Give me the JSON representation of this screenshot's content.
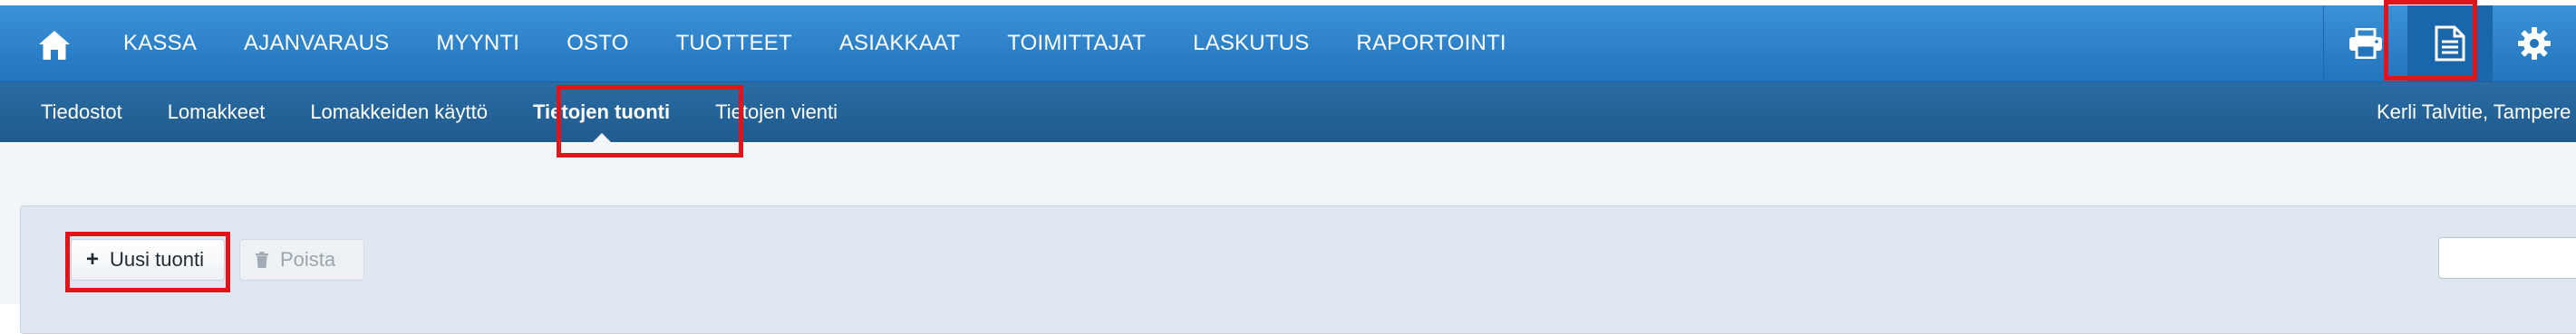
{
  "topnav": {
    "items": [
      {
        "label": "KASSA"
      },
      {
        "label": "AJANVARAUS"
      },
      {
        "label": "MYYNTI"
      },
      {
        "label": "OSTO"
      },
      {
        "label": "TUOTTEET"
      },
      {
        "label": "ASIAKKAAT"
      },
      {
        "label": "TOIMITTAJAT"
      },
      {
        "label": "LASKUTUS"
      },
      {
        "label": "RAPORTOINTI"
      }
    ],
    "icons": [
      "home-icon",
      "printer-icon",
      "document-icon",
      "gear-icon"
    ]
  },
  "subnav": {
    "items": [
      {
        "label": "Tiedostot"
      },
      {
        "label": "Lomakkeet"
      },
      {
        "label": "Lomakkeiden käyttö"
      },
      {
        "label": "Tietojen tuonti",
        "active": true
      },
      {
        "label": "Tietojen vienti"
      }
    ],
    "user": "Kerli Talvitie, Tampere"
  },
  "toolbar": {
    "new_label": "Uusi tuonti",
    "remove_label": "Poista",
    "search_value": ""
  },
  "colors": {
    "nav_blue": "#2a82cb",
    "subnav_blue": "#245f93",
    "highlight_red": "#e0141a"
  }
}
